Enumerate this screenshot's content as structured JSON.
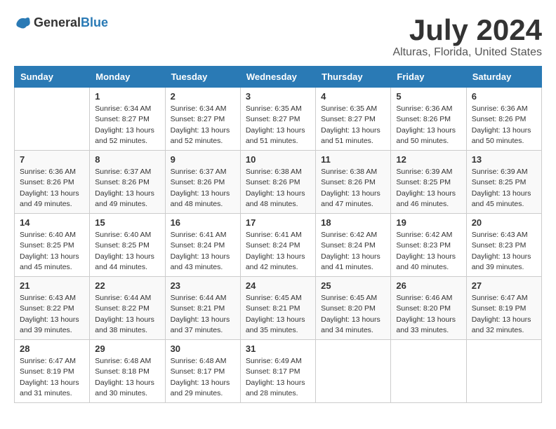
{
  "header": {
    "logo_general": "General",
    "logo_blue": "Blue",
    "month_title": "July 2024",
    "location": "Alturas, Florida, United States"
  },
  "calendar": {
    "days_of_week": [
      "Sunday",
      "Monday",
      "Tuesday",
      "Wednesday",
      "Thursday",
      "Friday",
      "Saturday"
    ],
    "weeks": [
      [
        {
          "day": "",
          "info": ""
        },
        {
          "day": "1",
          "info": "Sunrise: 6:34 AM\nSunset: 8:27 PM\nDaylight: 13 hours\nand 52 minutes."
        },
        {
          "day": "2",
          "info": "Sunrise: 6:34 AM\nSunset: 8:27 PM\nDaylight: 13 hours\nand 52 minutes."
        },
        {
          "day": "3",
          "info": "Sunrise: 6:35 AM\nSunset: 8:27 PM\nDaylight: 13 hours\nand 51 minutes."
        },
        {
          "day": "4",
          "info": "Sunrise: 6:35 AM\nSunset: 8:27 PM\nDaylight: 13 hours\nand 51 minutes."
        },
        {
          "day": "5",
          "info": "Sunrise: 6:36 AM\nSunset: 8:26 PM\nDaylight: 13 hours\nand 50 minutes."
        },
        {
          "day": "6",
          "info": "Sunrise: 6:36 AM\nSunset: 8:26 PM\nDaylight: 13 hours\nand 50 minutes."
        }
      ],
      [
        {
          "day": "7",
          "info": "Sunrise: 6:36 AM\nSunset: 8:26 PM\nDaylight: 13 hours\nand 49 minutes."
        },
        {
          "day": "8",
          "info": "Sunrise: 6:37 AM\nSunset: 8:26 PM\nDaylight: 13 hours\nand 49 minutes."
        },
        {
          "day": "9",
          "info": "Sunrise: 6:37 AM\nSunset: 8:26 PM\nDaylight: 13 hours\nand 48 minutes."
        },
        {
          "day": "10",
          "info": "Sunrise: 6:38 AM\nSunset: 8:26 PM\nDaylight: 13 hours\nand 48 minutes."
        },
        {
          "day": "11",
          "info": "Sunrise: 6:38 AM\nSunset: 8:26 PM\nDaylight: 13 hours\nand 47 minutes."
        },
        {
          "day": "12",
          "info": "Sunrise: 6:39 AM\nSunset: 8:25 PM\nDaylight: 13 hours\nand 46 minutes."
        },
        {
          "day": "13",
          "info": "Sunrise: 6:39 AM\nSunset: 8:25 PM\nDaylight: 13 hours\nand 45 minutes."
        }
      ],
      [
        {
          "day": "14",
          "info": "Sunrise: 6:40 AM\nSunset: 8:25 PM\nDaylight: 13 hours\nand 45 minutes."
        },
        {
          "day": "15",
          "info": "Sunrise: 6:40 AM\nSunset: 8:25 PM\nDaylight: 13 hours\nand 44 minutes."
        },
        {
          "day": "16",
          "info": "Sunrise: 6:41 AM\nSunset: 8:24 PM\nDaylight: 13 hours\nand 43 minutes."
        },
        {
          "day": "17",
          "info": "Sunrise: 6:41 AM\nSunset: 8:24 PM\nDaylight: 13 hours\nand 42 minutes."
        },
        {
          "day": "18",
          "info": "Sunrise: 6:42 AM\nSunset: 8:24 PM\nDaylight: 13 hours\nand 41 minutes."
        },
        {
          "day": "19",
          "info": "Sunrise: 6:42 AM\nSunset: 8:23 PM\nDaylight: 13 hours\nand 40 minutes."
        },
        {
          "day": "20",
          "info": "Sunrise: 6:43 AM\nSunset: 8:23 PM\nDaylight: 13 hours\nand 39 minutes."
        }
      ],
      [
        {
          "day": "21",
          "info": "Sunrise: 6:43 AM\nSunset: 8:22 PM\nDaylight: 13 hours\nand 39 minutes."
        },
        {
          "day": "22",
          "info": "Sunrise: 6:44 AM\nSunset: 8:22 PM\nDaylight: 13 hours\nand 38 minutes."
        },
        {
          "day": "23",
          "info": "Sunrise: 6:44 AM\nSunset: 8:21 PM\nDaylight: 13 hours\nand 37 minutes."
        },
        {
          "day": "24",
          "info": "Sunrise: 6:45 AM\nSunset: 8:21 PM\nDaylight: 13 hours\nand 35 minutes."
        },
        {
          "day": "25",
          "info": "Sunrise: 6:45 AM\nSunset: 8:20 PM\nDaylight: 13 hours\nand 34 minutes."
        },
        {
          "day": "26",
          "info": "Sunrise: 6:46 AM\nSunset: 8:20 PM\nDaylight: 13 hours\nand 33 minutes."
        },
        {
          "day": "27",
          "info": "Sunrise: 6:47 AM\nSunset: 8:19 PM\nDaylight: 13 hours\nand 32 minutes."
        }
      ],
      [
        {
          "day": "28",
          "info": "Sunrise: 6:47 AM\nSunset: 8:19 PM\nDaylight: 13 hours\nand 31 minutes."
        },
        {
          "day": "29",
          "info": "Sunrise: 6:48 AM\nSunset: 8:18 PM\nDaylight: 13 hours\nand 30 minutes."
        },
        {
          "day": "30",
          "info": "Sunrise: 6:48 AM\nSunset: 8:17 PM\nDaylight: 13 hours\nand 29 minutes."
        },
        {
          "day": "31",
          "info": "Sunrise: 6:49 AM\nSunset: 8:17 PM\nDaylight: 13 hours\nand 28 minutes."
        },
        {
          "day": "",
          "info": ""
        },
        {
          "day": "",
          "info": ""
        },
        {
          "day": "",
          "info": ""
        }
      ]
    ]
  }
}
